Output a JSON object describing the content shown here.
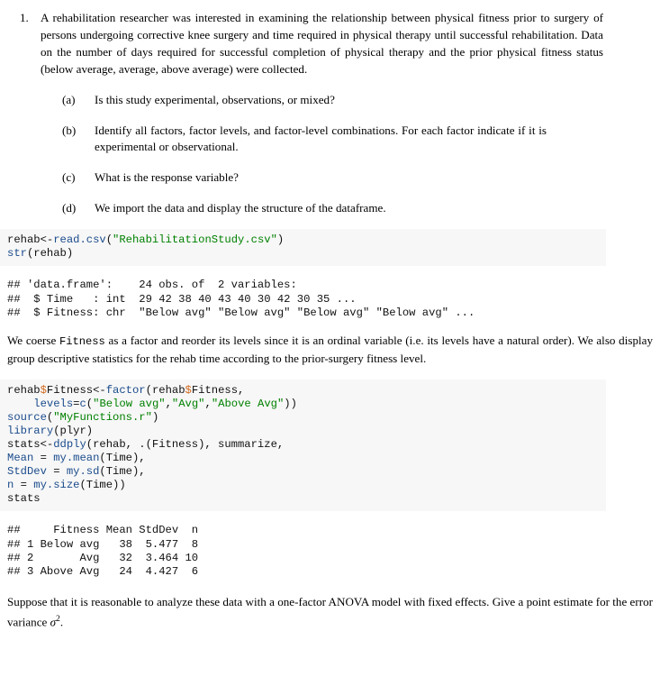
{
  "question": {
    "number": "1.",
    "stem": "A rehabilitation researcher was interested in examining the relationship between physical fitness prior to surgery of persons undergoing corrective knee surgery and time required in physical therapy until successful rehabilitation. Data on the number of days required for successful completion of physical therapy and the prior physical fitness status (below average, average, above average) were collected.",
    "parts": [
      {
        "marker": "(a)",
        "text": "Is this study experimental, observations, or mixed?"
      },
      {
        "marker": "(b)",
        "text": "Identify all factors, factor levels, and factor-level combinations. For each factor indicate if it is experimental or observational."
      },
      {
        "marker": "(c)",
        "text": "What is the response variable?"
      },
      {
        "marker": "(d)",
        "text": "We import the data and display the structure of the dataframe."
      }
    ]
  },
  "code_block_1": {
    "lines": [
      "rehab<-read.csv(\"RehabilitationStudy.csv\")",
      "str(rehab)"
    ]
  },
  "output_block_1": {
    "lines": [
      "## 'data.frame':    24 obs. of  2 variables:",
      "##  $ Time   : int  29 42 38 40 43 40 30 42 30 35 ...",
      "##  $ Fitness: chr  \"Below avg\" \"Below avg\" \"Below avg\" \"Below avg\" ..."
    ]
  },
  "paragraph_coerce": {
    "before": "We coerse ",
    "code": "Fitness",
    "after": " as a factor and reorder its levels since it is an ordinal variable (i.e. its levels have a natural order). We also display group descriptive statistics for the rehab time according to the prior-surgery fitness level."
  },
  "code_block_2": {
    "lines": [
      "rehab$Fitness<-factor(rehab$Fitness,",
      "    levels=c(\"Below avg\",\"Avg\",\"Above Avg\"))",
      "source(\"MyFunctions.r\")",
      "library(plyr)",
      "stats<-ddply(rehab, .(Fitness), summarize,",
      "Mean = my.mean(Time),",
      "StdDev = my.sd(Time),",
      "n = my.size(Time))",
      "stats"
    ]
  },
  "output_block_2": {
    "header": "##     Fitness Mean StdDev  n",
    "rows": [
      "## 1 Below avg   38  5.477  8",
      "## 2       Avg   32  3.464 10",
      "## 3 Above Avg   24  4.427  6"
    ],
    "table": {
      "columns": [
        "",
        "Fitness",
        "Mean",
        "StdDev",
        "n"
      ],
      "rows": [
        [
          "1",
          "Below avg",
          "38",
          "5.477",
          "8"
        ],
        [
          "2",
          "Avg",
          "32",
          "3.464",
          "10"
        ],
        [
          "3",
          "Above Avg",
          "24",
          "4.427",
          "6"
        ]
      ]
    }
  },
  "closing_paragraph": {
    "before": "Suppose that it is reasonable to analyze these data with a one-factor ANOVA model with fixed effects. Give a point estimate for the error variance ",
    "symbol": "σ",
    "exponent": "2",
    "after": "."
  },
  "colors": {
    "code_background": "#f7f7f7",
    "function_blue": "#1a4b8c",
    "string_green": "#008000",
    "dollar_orange": "#d2691e",
    "text": "#000000",
    "page_background": "#ffffff"
  }
}
